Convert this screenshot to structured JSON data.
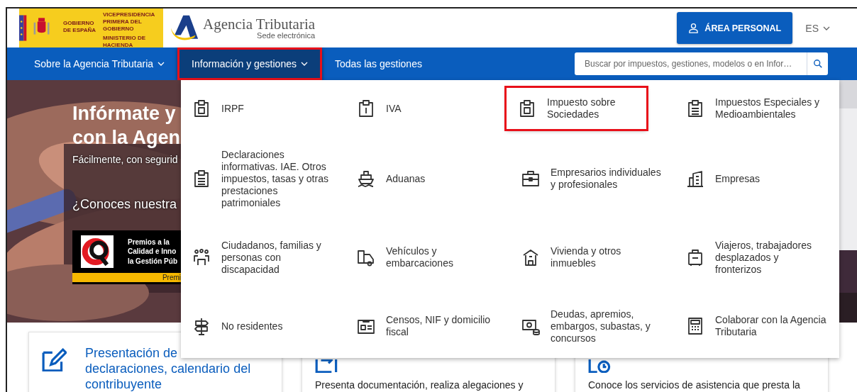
{
  "header": {
    "gov_logo": {
      "government": [
        "GOBIERNO",
        "DE ESPAÑA"
      ],
      "vice": [
        "VICEPRESIDENCIA",
        "PRIMERA DEL GOBIERNO"
      ],
      "ministry": [
        "MINISTERIO",
        "DE HACIENDA"
      ]
    },
    "brand": "Agencia Tributaria",
    "brand_sub": "Sede electrónica",
    "personal_button": "ÁREA PERSONAL",
    "language": "ES"
  },
  "nav": {
    "items": [
      {
        "label": "Sobre la Agencia Tributaria",
        "dropdown": true,
        "selected": false,
        "highlighted": false
      },
      {
        "label": "Información y gestiones",
        "dropdown": true,
        "selected": true,
        "highlighted": true
      },
      {
        "label": "Todas las gestiones",
        "dropdown": false,
        "selected": false,
        "highlighted": false
      }
    ],
    "search": {
      "placeholder": "Buscar por impuestos, gestiones, modelos o en Infor…"
    }
  },
  "hero": {
    "heading": [
      "Infórmate y",
      "con la Agen"
    ],
    "subtitle": "Fácilmente, con segurid",
    "question": "¿Conoces nuestra",
    "award": {
      "lines": [
        "Premios a la",
        "Calidad e Inno",
        "la Gestión Púb"
      ],
      "strip": "Premi"
    }
  },
  "menu": {
    "items": [
      {
        "label": "IRPF",
        "highlighted": false
      },
      {
        "label": "IVA",
        "highlighted": false
      },
      {
        "label": "Impuesto sobre Sociedades",
        "highlighted": true
      },
      {
        "label": "Impuestos Especiales y Medioambientales",
        "highlighted": false
      },
      {
        "label": "Declaraciones informativas. IAE. Otros impuestos, tasas y otras prestaciones patrimoniales",
        "highlighted": false
      },
      {
        "label": "Aduanas",
        "highlighted": false
      },
      {
        "label": "Empresarios individuales y profesionales",
        "highlighted": false
      },
      {
        "label": "Empresas",
        "highlighted": false
      },
      {
        "label": "Ciudadanos, familias y personas con discapacidad",
        "highlighted": false
      },
      {
        "label": "Vehículos y embarcaciones",
        "highlighted": false
      },
      {
        "label": "Vivienda y otros inmuebles",
        "highlighted": false
      },
      {
        "label": "Viajeros, trabajadores desplazados y fronterizos",
        "highlighted": false
      },
      {
        "label": "No residentes",
        "highlighted": false
      },
      {
        "label": "Censos, NIF y domicilio fiscal",
        "highlighted": false
      },
      {
        "label": "Deudas, apremios, embargos, subastas, y concursos",
        "highlighted": false
      },
      {
        "label": "Colaborar con la Agencia Tributaria",
        "highlighted": false
      }
    ]
  },
  "cards": [
    {
      "title": "Presentación de declaraciones, calendario del contribuyente"
    },
    {
      "description": "Presenta documentación, realiza alegaciones y"
    },
    {
      "description": "Conoce los servicios de asistencia que presta la"
    }
  ]
}
